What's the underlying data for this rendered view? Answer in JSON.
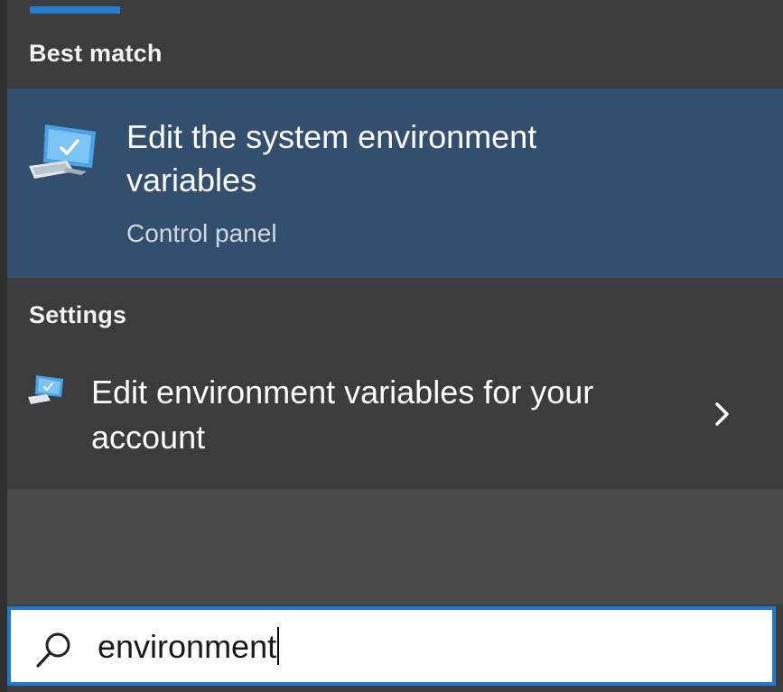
{
  "search_panel": {
    "best_match_label": "Best match",
    "best_match": {
      "title": "Edit the system environment variables",
      "subtitle": "Control panel",
      "icon": "computer-settings-icon"
    },
    "settings_label": "Settings",
    "settings_result": {
      "title": "Edit environment variables for your account",
      "icon": "computer-settings-icon",
      "action_icon": "chevron-right-icon"
    }
  },
  "search_box": {
    "value": "environment",
    "icon": "search-icon"
  },
  "colors": {
    "accent": "#1e7ad1",
    "selected_item_bg": "#32506d",
    "panel_bg": "#3c3c3c"
  }
}
